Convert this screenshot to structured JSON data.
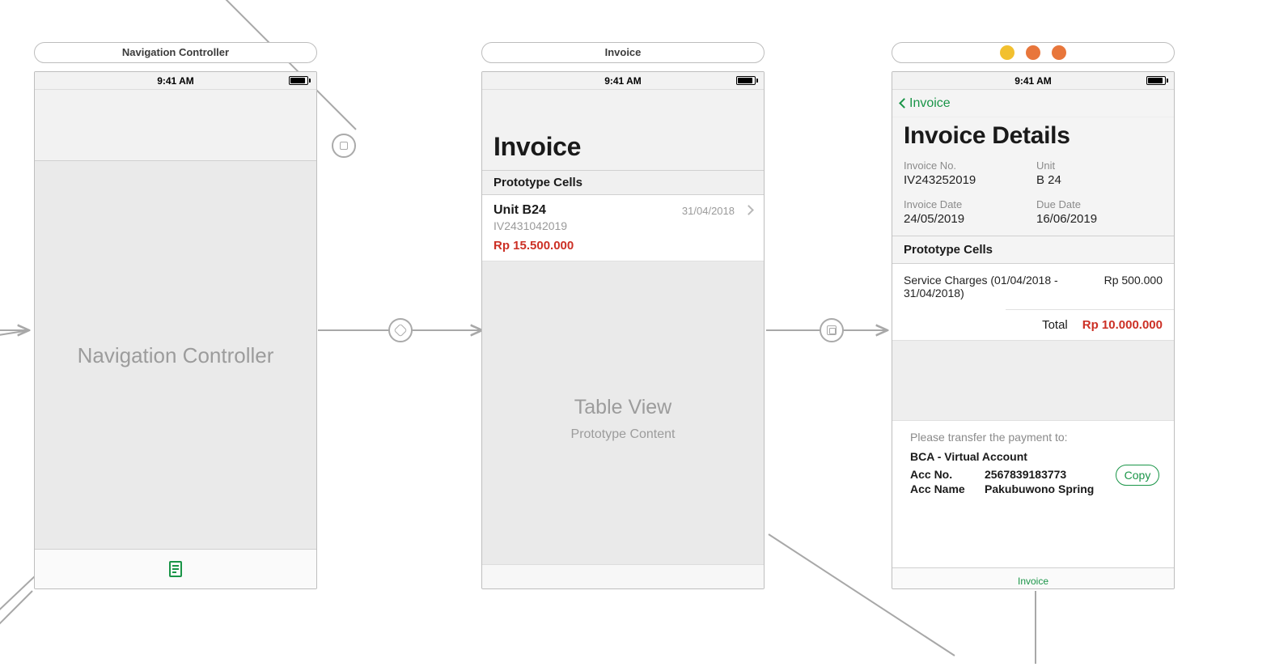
{
  "status": {
    "time": "9:41 AM"
  },
  "scene1": {
    "title": "Navigation Controller",
    "placeholder": "Navigation Controller"
  },
  "scene2": {
    "title": "Invoice",
    "header": "Invoice",
    "section": "Prototype Cells",
    "cell": {
      "unit": "Unit B24",
      "invoice_no": "IV2431042019",
      "amount": "Rp 15.500.000",
      "date": "31/04/2018"
    },
    "tableview": {
      "t1": "Table View",
      "t2": "Prototype Content"
    }
  },
  "scene3": {
    "back_label": "Invoice",
    "header": "Invoice Details",
    "fields": {
      "invoice_no_label": "Invoice No.",
      "invoice_no": "IV243252019",
      "unit_label": "Unit",
      "unit": "B 24",
      "invoice_date_label": "Invoice Date",
      "invoice_date": "24/05/2019",
      "due_date_label": "Due Date",
      "due_date": "16/06/2019"
    },
    "section": "Prototype Cells",
    "line": {
      "label": "Service Charges (01/04/2018 - 31/04/2018)",
      "value": "Rp 500.000"
    },
    "total": {
      "label": "Total",
      "value": "Rp 10.000.000"
    },
    "payment": {
      "hint": "Please transfer the payment to:",
      "bank": "BCA - Virtual Account",
      "acc_no_label": "Acc No.",
      "acc_no": "2567839183773",
      "acc_name_label": "Acc Name",
      "acc_name": "Pakubuwono Spring",
      "copy": "Copy"
    },
    "tab_label": "Invoice"
  }
}
